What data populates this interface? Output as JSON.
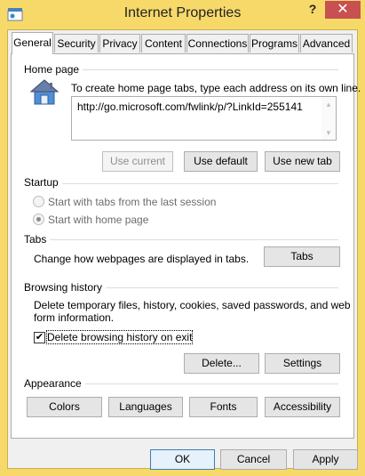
{
  "window": {
    "title": "Internet Properties",
    "help_glyph": "?",
    "close_glyph": "✕"
  },
  "tabs": [
    "General",
    "Security",
    "Privacy",
    "Content",
    "Connections",
    "Programs",
    "Advanced"
  ],
  "home_page": {
    "section_label": "Home page",
    "instructions": "To create home page tabs, type each address on its own line.",
    "url": "http://go.microsoft.com/fwlink/p/?LinkId=255141",
    "use_current": "Use current",
    "use_default": "Use default",
    "use_new_tab": "Use new tab"
  },
  "startup": {
    "section_label": "Startup",
    "option_last_session": "Start with tabs from the last session",
    "option_home_page": "Start with home page",
    "selected": "home_page"
  },
  "tabs_section": {
    "section_label": "Tabs",
    "description": "Change how webpages are displayed in tabs.",
    "button": "Tabs"
  },
  "browsing_history": {
    "section_label": "Browsing history",
    "description_line1": "Delete temporary files, history, cookies, saved passwords, and web",
    "description_line2": "form information.",
    "checkbox_label": "Delete browsing history on exit",
    "checkbox_checked": true,
    "delete_button": "Delete...",
    "settings_button": "Settings"
  },
  "appearance": {
    "section_label": "Appearance",
    "colors": "Colors",
    "languages": "Languages",
    "fonts": "Fonts",
    "accessibility": "Accessibility"
  },
  "footer": {
    "ok": "OK",
    "cancel": "Cancel",
    "apply": "Apply"
  },
  "colors": {
    "title_bar": "#f7d96a",
    "close_button": "#c75050",
    "panel": "#ffffff"
  }
}
